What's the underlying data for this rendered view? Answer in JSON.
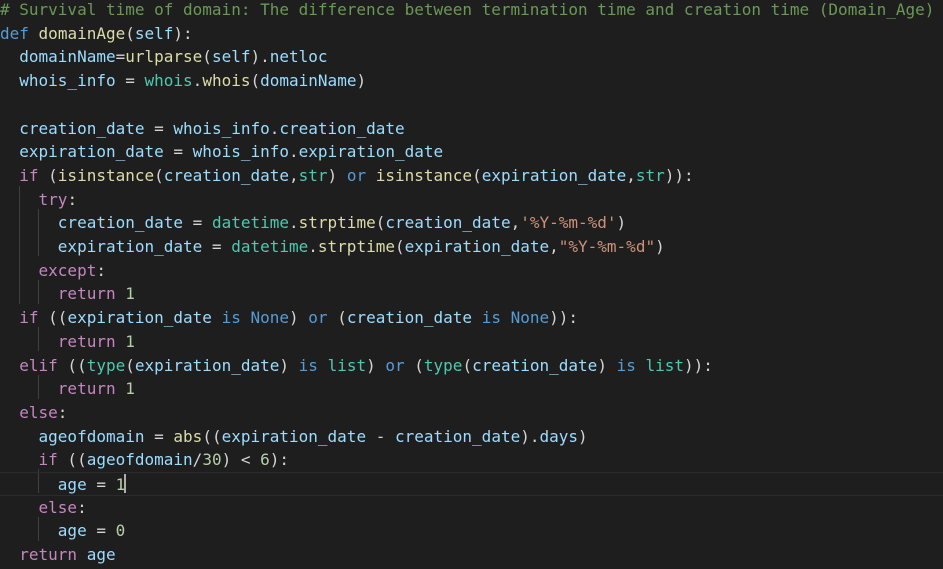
{
  "editor": {
    "language": "python",
    "theme": "dark",
    "colors": {
      "background": "#1e1e1e",
      "comment": "#6a9955",
      "keyword": "#569cd6",
      "control": "#c586c0",
      "function": "#dcdcaa",
      "variable": "#9cdcfe",
      "module": "#4ec9b0",
      "string": "#ce9178",
      "number": "#b5cea8",
      "text": "#d4d4d4"
    },
    "cursor_line": 20,
    "lines": [
      [
        [
          "comment",
          "# Survival time of domain: The difference between termination time and creation time (Domain_Age)"
        ]
      ],
      [
        [
          "keyword",
          "def"
        ],
        [
          "plain",
          " "
        ],
        [
          "func",
          "domainAge"
        ],
        [
          "punct",
          "("
        ],
        [
          "param",
          "self"
        ],
        [
          "punct",
          "):"
        ]
      ],
      [
        [
          "plain",
          "  "
        ],
        [
          "variable",
          "domainName"
        ],
        [
          "operator",
          "="
        ],
        [
          "func",
          "urlparse"
        ],
        [
          "punct",
          "("
        ],
        [
          "param",
          "self"
        ],
        [
          "punct",
          ")."
        ],
        [
          "variable",
          "netloc"
        ]
      ],
      [
        [
          "plain",
          "  "
        ],
        [
          "variable",
          "whois_info"
        ],
        [
          "operator",
          " = "
        ],
        [
          "module",
          "whois"
        ],
        [
          "punct",
          "."
        ],
        [
          "func",
          "whois"
        ],
        [
          "punct",
          "("
        ],
        [
          "variable",
          "domainName"
        ],
        [
          "punct",
          ")"
        ]
      ],
      [],
      [
        [
          "plain",
          "  "
        ],
        [
          "variable",
          "creation_date"
        ],
        [
          "operator",
          " = "
        ],
        [
          "variable",
          "whois_info"
        ],
        [
          "punct",
          "."
        ],
        [
          "variable",
          "creation_date"
        ]
      ],
      [
        [
          "plain",
          "  "
        ],
        [
          "variable",
          "expiration_date"
        ],
        [
          "operator",
          " = "
        ],
        [
          "variable",
          "whois_info"
        ],
        [
          "punct",
          "."
        ],
        [
          "variable",
          "expiration_date"
        ]
      ],
      [
        [
          "plain",
          "  "
        ],
        [
          "control",
          "if"
        ],
        [
          "plain",
          " ("
        ],
        [
          "func",
          "isinstance"
        ],
        [
          "punct",
          "("
        ],
        [
          "variable",
          "creation_date"
        ],
        [
          "punct",
          ","
        ],
        [
          "builtin",
          "str"
        ],
        [
          "punct",
          ")"
        ],
        [
          "plain",
          " "
        ],
        [
          "keyword",
          "or"
        ],
        [
          "plain",
          " "
        ],
        [
          "func",
          "isinstance"
        ],
        [
          "punct",
          "("
        ],
        [
          "variable",
          "expiration_date"
        ],
        [
          "punct",
          ","
        ],
        [
          "builtin",
          "str"
        ],
        [
          "punct",
          ")):"
        ]
      ],
      [
        [
          "plain",
          "    "
        ],
        [
          "control",
          "try"
        ],
        [
          "punct",
          ":"
        ]
      ],
      [
        [
          "plain",
          "      "
        ],
        [
          "variable",
          "creation_date"
        ],
        [
          "operator",
          " = "
        ],
        [
          "module",
          "datetime"
        ],
        [
          "punct",
          "."
        ],
        [
          "func",
          "strptime"
        ],
        [
          "punct",
          "("
        ],
        [
          "variable",
          "creation_date"
        ],
        [
          "punct",
          ","
        ],
        [
          "string",
          "'%Y-%m-%d'"
        ],
        [
          "punct",
          ")"
        ]
      ],
      [
        [
          "plain",
          "      "
        ],
        [
          "variable",
          "expiration_date"
        ],
        [
          "operator",
          " = "
        ],
        [
          "module",
          "datetime"
        ],
        [
          "punct",
          "."
        ],
        [
          "func",
          "strptime"
        ],
        [
          "punct",
          "("
        ],
        [
          "variable",
          "expiration_date"
        ],
        [
          "punct",
          ","
        ],
        [
          "string",
          "\"%Y-%m-%d\""
        ],
        [
          "punct",
          ")"
        ]
      ],
      [
        [
          "plain",
          "    "
        ],
        [
          "control",
          "except"
        ],
        [
          "punct",
          ":"
        ]
      ],
      [
        [
          "plain",
          "      "
        ],
        [
          "control",
          "return"
        ],
        [
          "plain",
          " "
        ],
        [
          "number",
          "1"
        ]
      ],
      [
        [
          "plain",
          "  "
        ],
        [
          "control",
          "if"
        ],
        [
          "plain",
          " (("
        ],
        [
          "variable",
          "expiration_date"
        ],
        [
          "plain",
          " "
        ],
        [
          "keyword",
          "is"
        ],
        [
          "plain",
          " "
        ],
        [
          "keyword",
          "None"
        ],
        [
          "punct",
          ")"
        ],
        [
          "plain",
          " "
        ],
        [
          "keyword",
          "or"
        ],
        [
          "plain",
          " ("
        ],
        [
          "variable",
          "creation_date"
        ],
        [
          "plain",
          " "
        ],
        [
          "keyword",
          "is"
        ],
        [
          "plain",
          " "
        ],
        [
          "keyword",
          "None"
        ],
        [
          "punct",
          ")):"
        ]
      ],
      [
        [
          "plain",
          "      "
        ],
        [
          "control",
          "return"
        ],
        [
          "plain",
          " "
        ],
        [
          "number",
          "1"
        ]
      ],
      [
        [
          "plain",
          "  "
        ],
        [
          "control",
          "elif"
        ],
        [
          "plain",
          " (("
        ],
        [
          "builtin",
          "type"
        ],
        [
          "punct",
          "("
        ],
        [
          "variable",
          "expiration_date"
        ],
        [
          "punct",
          ")"
        ],
        [
          "plain",
          " "
        ],
        [
          "keyword",
          "is"
        ],
        [
          "plain",
          " "
        ],
        [
          "builtin",
          "list"
        ],
        [
          "punct",
          ")"
        ],
        [
          "plain",
          " "
        ],
        [
          "keyword",
          "or"
        ],
        [
          "plain",
          " ("
        ],
        [
          "builtin",
          "type"
        ],
        [
          "punct",
          "("
        ],
        [
          "variable",
          "creation_date"
        ],
        [
          "punct",
          ")"
        ],
        [
          "plain",
          " "
        ],
        [
          "keyword",
          "is"
        ],
        [
          "plain",
          " "
        ],
        [
          "builtin",
          "list"
        ],
        [
          "punct",
          ")):"
        ]
      ],
      [
        [
          "plain",
          "      "
        ],
        [
          "control",
          "return"
        ],
        [
          "plain",
          " "
        ],
        [
          "number",
          "1"
        ]
      ],
      [
        [
          "plain",
          "  "
        ],
        [
          "control",
          "else"
        ],
        [
          "punct",
          ":"
        ]
      ],
      [
        [
          "plain",
          "    "
        ],
        [
          "variable",
          "ageofdomain"
        ],
        [
          "operator",
          " = "
        ],
        [
          "func",
          "abs"
        ],
        [
          "punct",
          "(("
        ],
        [
          "variable",
          "expiration_date"
        ],
        [
          "operator",
          " - "
        ],
        [
          "variable",
          "creation_date"
        ],
        [
          "punct",
          ")."
        ],
        [
          "variable",
          "days"
        ],
        [
          "punct",
          ")"
        ]
      ],
      [
        [
          "plain",
          "    "
        ],
        [
          "control",
          "if"
        ],
        [
          "plain",
          " (("
        ],
        [
          "variable",
          "ageofdomain"
        ],
        [
          "operator",
          "/"
        ],
        [
          "number",
          "30"
        ],
        [
          "punct",
          ")"
        ],
        [
          "operator",
          " < "
        ],
        [
          "number",
          "6"
        ],
        [
          "punct",
          "):"
        ]
      ],
      [
        [
          "plain",
          "      "
        ],
        [
          "variable",
          "age"
        ],
        [
          "operator",
          " = "
        ],
        [
          "number",
          "1"
        ]
      ],
      [
        [
          "plain",
          "    "
        ],
        [
          "control",
          "else"
        ],
        [
          "punct",
          ":"
        ]
      ],
      [
        [
          "plain",
          "      "
        ],
        [
          "variable",
          "age"
        ],
        [
          "operator",
          " = "
        ],
        [
          "number",
          "0"
        ]
      ],
      [
        [
          "plain",
          "  "
        ],
        [
          "control",
          "return"
        ],
        [
          "plain",
          " "
        ],
        [
          "variable",
          "age"
        ]
      ]
    ]
  }
}
